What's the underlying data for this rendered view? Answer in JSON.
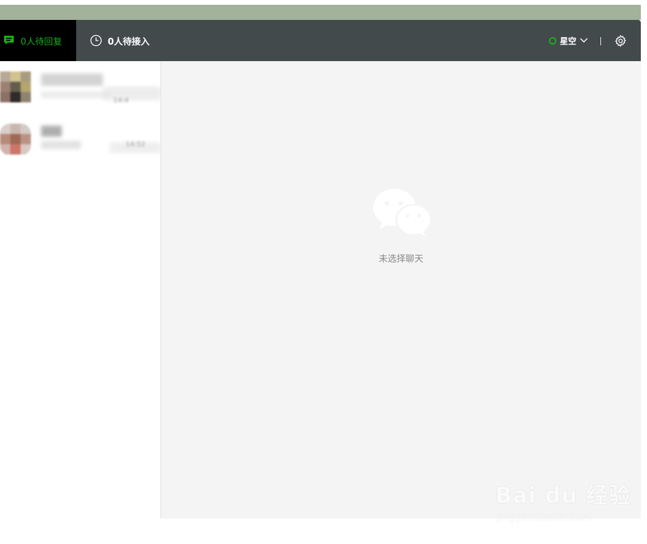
{
  "header": {
    "tabs": [
      {
        "label": "0人待回复",
        "icon": "chat-bubble-icon",
        "active": true
      },
      {
        "label": "0人待接入",
        "icon": "clock-icon",
        "active": false
      }
    ],
    "user": {
      "name": "星空",
      "status_color": "#1aad19"
    },
    "settings_icon": "gear-icon"
  },
  "contacts": [
    {
      "time": "14:4"
    },
    {
      "time": "14:52"
    }
  ],
  "main": {
    "empty_text": "未选择聊天",
    "empty_icon": "wechat-logo-icon"
  },
  "watermark": {
    "brand": "Bai du 经验",
    "domain": "jingyan.baidu.com"
  },
  "colors": {
    "accent": "#1aad19",
    "header_bg": "#434a4c",
    "content_bg": "#f4f4f4"
  }
}
